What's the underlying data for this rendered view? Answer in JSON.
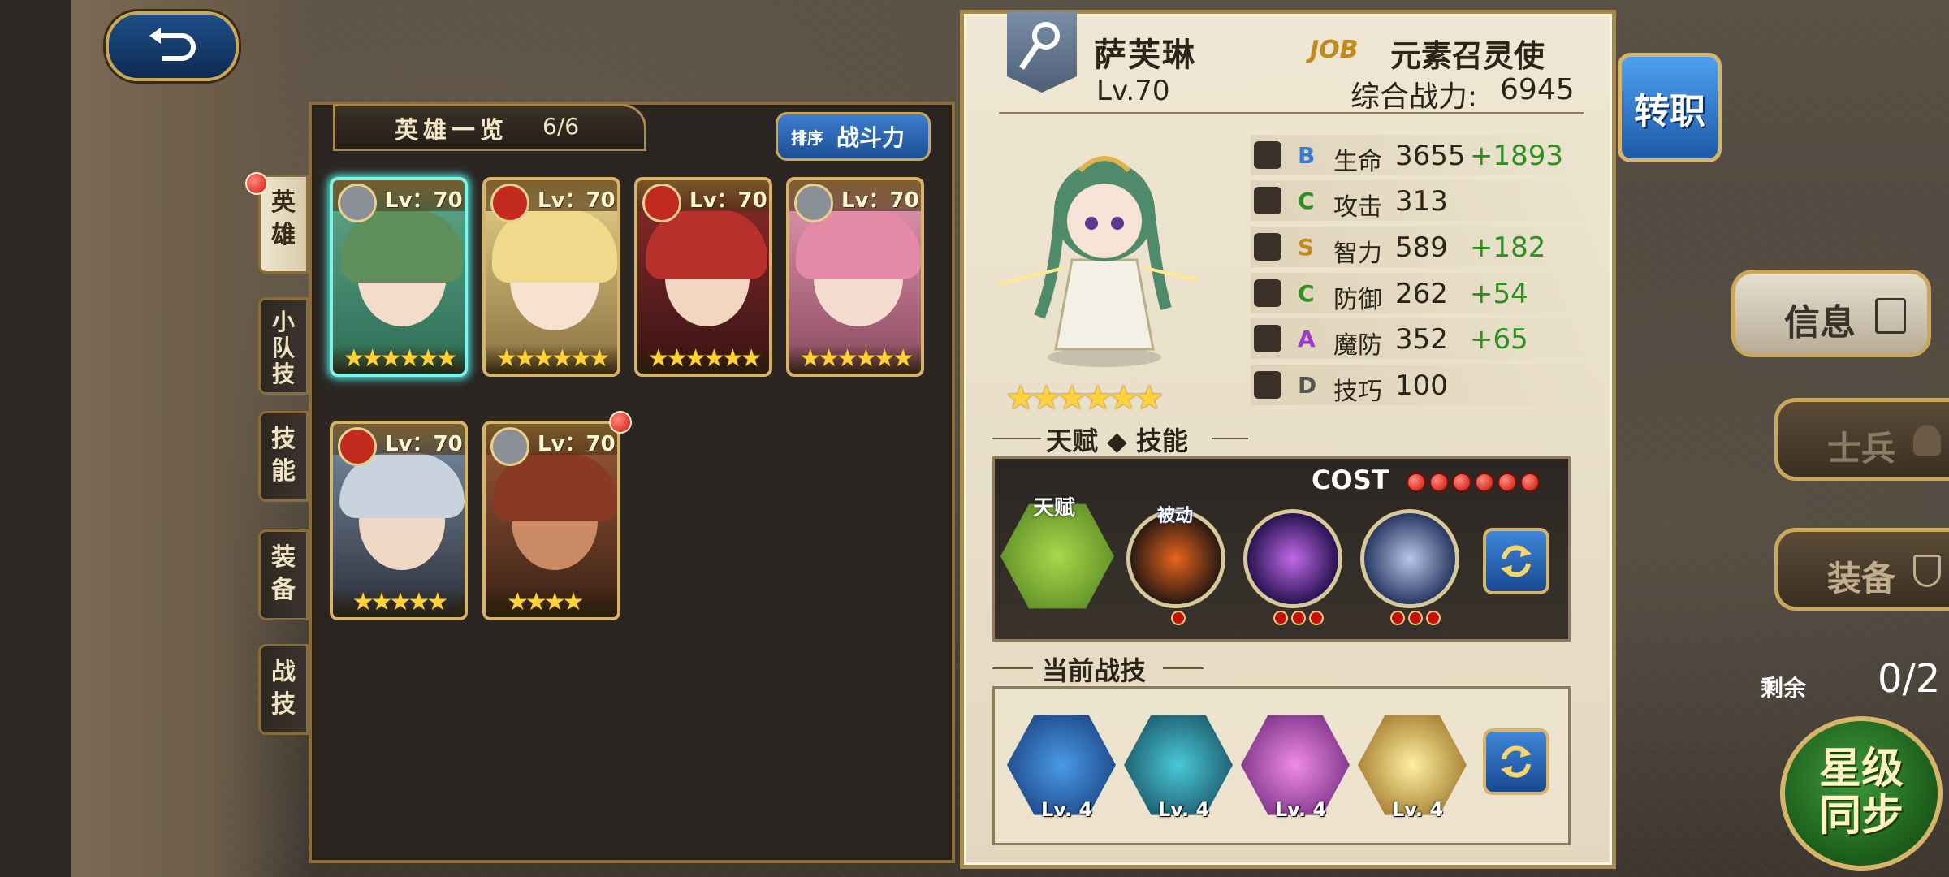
{
  "nav": {
    "back": "back-arrow",
    "side_tabs": [
      "英雄",
      "小队技",
      "技能",
      "装备",
      "战技"
    ]
  },
  "hero_list": {
    "title": "英雄一览",
    "count": "6/6",
    "sort_label": "排序",
    "sort_value": "战斗力",
    "heroes": [
      {
        "level": "Lv：70",
        "class": "staff",
        "stars": "★★★★★★",
        "selected": true
      },
      {
        "level": "Lv：70",
        "class": "sword",
        "stars": "★★★★★★"
      },
      {
        "level": "Lv：70",
        "class": "sword",
        "stars": "★★★★★★"
      },
      {
        "level": "Lv：70",
        "class": "staff",
        "stars": "★★★★★★"
      },
      {
        "level": "Lv：70",
        "class": "sword",
        "stars": "★★★★★"
      },
      {
        "level": "Lv：70",
        "class": "whip",
        "stars": "★★★★",
        "new": true
      }
    ]
  },
  "detail": {
    "name": "萨芙琳",
    "level": "Lv.70",
    "job_label": "JOB",
    "job_name": "元素召灵使",
    "power_label": "综合战力:",
    "power_value": "6945",
    "stars": "★★★★★★",
    "stats": [
      {
        "grade": "B",
        "name": "生命",
        "value": "3655",
        "bonus": "+1893",
        "grade_color": "#3a7bd5"
      },
      {
        "grade": "C",
        "name": "攻击",
        "value": "313",
        "bonus": "",
        "grade_color": "#2f8f21"
      },
      {
        "grade": "S",
        "name": "智力",
        "value": "589",
        "bonus": "+182",
        "grade_color": "#c08a1c"
      },
      {
        "grade": "C",
        "name": "防御",
        "value": "262",
        "bonus": "+54",
        "grade_color": "#2f8f21"
      },
      {
        "grade": "A",
        "name": "魔防",
        "value": "352",
        "bonus": "+65",
        "grade_color": "#9b3ad0"
      },
      {
        "grade": "D",
        "name": "技巧",
        "value": "100",
        "bonus": "",
        "grade_color": "#555555"
      }
    ],
    "talent_section": "天赋 ◆ 技能",
    "cost_label": "COST",
    "talent_label": "天赋",
    "passive_label": "被动",
    "tech_section": "当前战技",
    "tech_levels": [
      "Lv. 4",
      "Lv. 4",
      "Lv. 4",
      "Lv. 4"
    ]
  },
  "right": {
    "job_change": "转职",
    "info": "信息",
    "soldier": "士兵",
    "equip": "装备",
    "remain_label": "剩余",
    "remain_value": "0/2",
    "star_sync": "星级同步"
  }
}
